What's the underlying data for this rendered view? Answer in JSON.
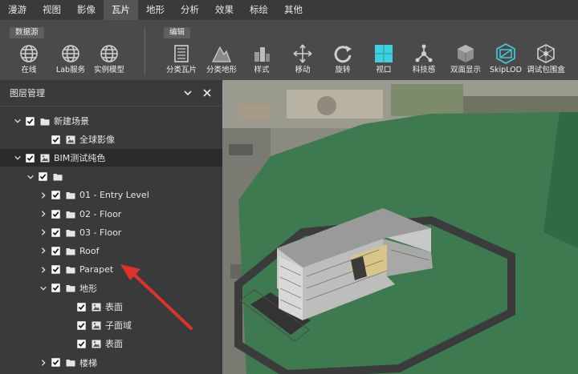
{
  "menu": {
    "tabs": [
      {
        "label": "漫游",
        "active": false
      },
      {
        "label": "视图",
        "active": false
      },
      {
        "label": "影像",
        "active": false
      },
      {
        "label": "瓦片",
        "active": true
      },
      {
        "label": "地形",
        "active": false
      },
      {
        "label": "分析",
        "active": false
      },
      {
        "label": "效果",
        "active": false
      },
      {
        "label": "标绘",
        "active": false
      },
      {
        "label": "其他",
        "active": false
      }
    ]
  },
  "ribbon": {
    "groups": {
      "datasource": "数据源",
      "edit": "编辑"
    },
    "tools": [
      {
        "label": "在线",
        "icon": "globe-icon"
      },
      {
        "label": "Lab服务",
        "icon": "globe-icon"
      },
      {
        "label": "实例模型",
        "icon": "globe-icon"
      },
      {
        "label": "分类瓦片",
        "icon": "building-tiles-icon"
      },
      {
        "label": "分类地形",
        "icon": "terrain-icon"
      },
      {
        "label": "样式",
        "icon": "style-icon"
      },
      {
        "label": "移动",
        "icon": "move-icon"
      },
      {
        "label": "旋转",
        "icon": "rotate-icon"
      },
      {
        "label": "视口",
        "icon": "viewport-icon"
      },
      {
        "label": "科技感",
        "icon": "tech-icon"
      },
      {
        "label": "双面显示",
        "icon": "double-side-icon"
      },
      {
        "label": "SkipLOD",
        "icon": "skiplod-icon"
      },
      {
        "label": "调试包围盒",
        "icon": "bounding-box-icon"
      }
    ]
  },
  "panel": {
    "title": "图层管理",
    "tree": [
      {
        "label": "新建场景",
        "type": "folder",
        "expand": "down"
      },
      {
        "label": "全球影像",
        "type": "layer",
        "expand": "none"
      },
      {
        "label": "BIM测试纯色",
        "type": "layer",
        "expand": "down",
        "selected": true
      },
      {
        "label": "",
        "type": "folder",
        "expand": "down"
      },
      {
        "label": "01 - Entry Level",
        "type": "folder",
        "expand": "right"
      },
      {
        "label": "02 - Floor",
        "type": "folder",
        "expand": "right"
      },
      {
        "label": "03 - Floor",
        "type": "folder",
        "expand": "right"
      },
      {
        "label": "Roof",
        "type": "folder",
        "expand": "right"
      },
      {
        "label": "Parapet",
        "type": "folder",
        "expand": "right"
      },
      {
        "label": "地形",
        "type": "folder",
        "expand": "down"
      },
      {
        "label": "表面",
        "type": "layer",
        "expand": "none"
      },
      {
        "label": "子面域",
        "type": "layer",
        "expand": "none"
      },
      {
        "label": "表面",
        "type": "layer",
        "expand": "none"
      },
      {
        "label": "楼梯",
        "type": "folder",
        "expand": "right"
      }
    ]
  },
  "colors": {
    "accent": "#3fd0e0",
    "arrow": "#e0302a",
    "ground": "#3f7a4e"
  }
}
